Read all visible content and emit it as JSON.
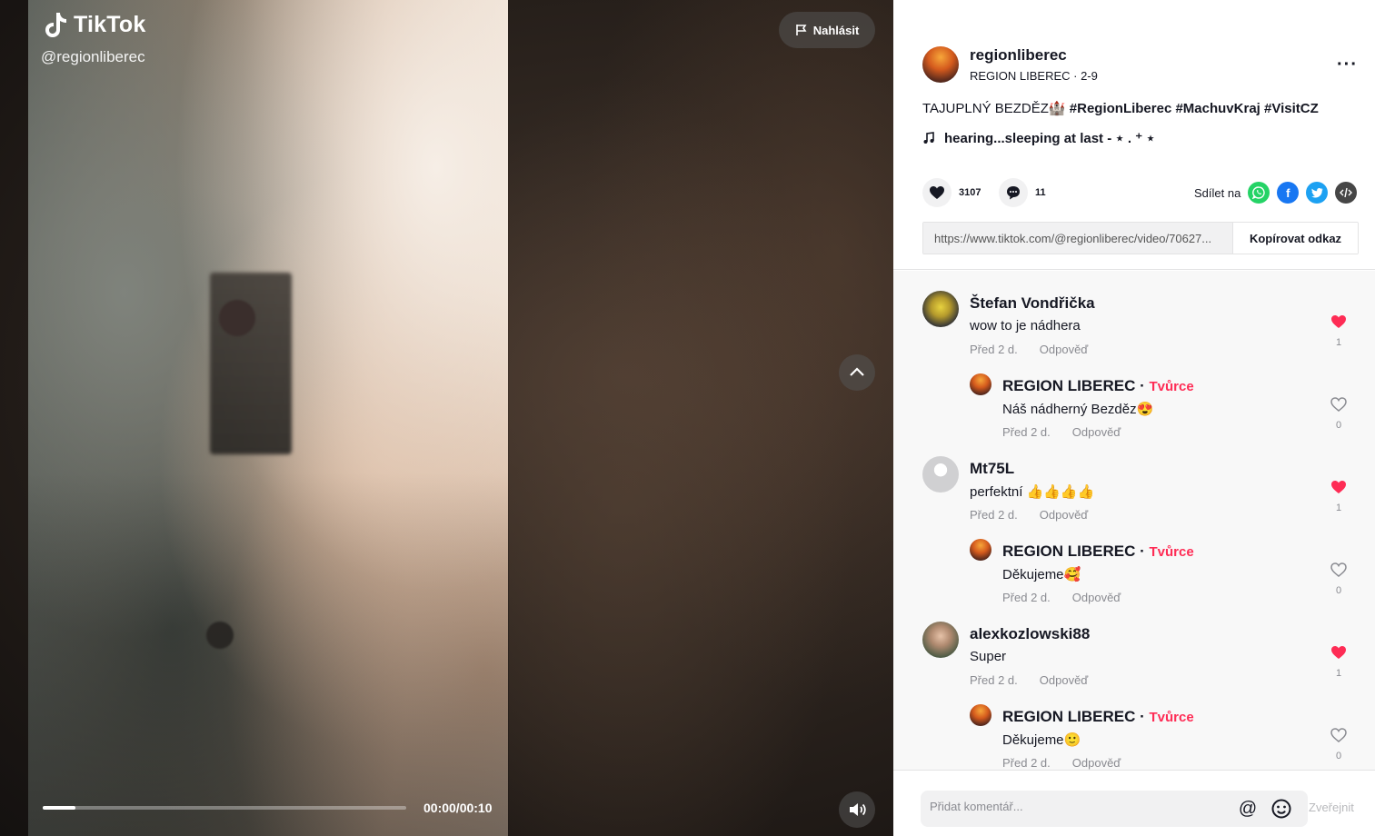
{
  "brand": {
    "name": "TikTok"
  },
  "video": {
    "handle": "@regionliberec",
    "report_label": "Nahlásit",
    "time": "00:00/00:10",
    "progress": 0.09
  },
  "author": {
    "username": "regionliberec",
    "subtitle": "REGION LIBEREC · 2-9"
  },
  "caption": {
    "text": "TAJUPLNÝ BEZDĚZ🏰",
    "tags": "#RegionLiberec #MachuvKraj #VisitCZ"
  },
  "music": {
    "icon": "music-note-icon",
    "title": "hearing...sleeping at last - ⋆ . ⁺ ⋆"
  },
  "stats": {
    "likes": "3107",
    "comments": "11"
  },
  "share": {
    "label": "Sdílet na",
    "targets": [
      {
        "name": "whatsapp-icon",
        "color": "#25d366"
      },
      {
        "name": "facebook-icon",
        "color": "#1877f2"
      },
      {
        "name": "twitter-icon",
        "color": "#1da1f2"
      },
      {
        "name": "embed-icon",
        "color": "#464646"
      }
    ]
  },
  "link": {
    "url": "https://www.tiktok.com/@regionliberec/video/70627...",
    "copy_label": "Kopírovat odkaz"
  },
  "comments": [
    {
      "user": "Štefan Vondřička",
      "text": "wow to je nádhera",
      "time": "Před 2 d.",
      "reply": "Odpověď",
      "likes": "1",
      "liked": true,
      "replies": [
        {
          "user": "REGION LIBEREC",
          "badge": "Tvůrce",
          "text": "Náš nádherný Bezděz😍",
          "time": "Před 2 d.",
          "reply": "Odpověď",
          "likes": "0",
          "liked": false
        }
      ]
    },
    {
      "user": "Mt75L",
      "text": "perfektní 👍👍👍👍",
      "time": "Před 2 d.",
      "reply": "Odpověď",
      "likes": "1",
      "liked": true,
      "replies": [
        {
          "user": "REGION LIBEREC",
          "badge": "Tvůrce",
          "text": "Děkujeme🥰",
          "time": "Před 2 d.",
          "reply": "Odpověď",
          "likes": "0",
          "liked": false
        }
      ]
    },
    {
      "user": "alexkozlowski88",
      "text": "Super",
      "time": "Před 2 d.",
      "reply": "Odpověď",
      "likes": "1",
      "liked": true,
      "replies": [
        {
          "user": "REGION LIBEREC",
          "badge": "Tvůrce",
          "text": "Děkujeme🙂",
          "time": "Před 2 d.",
          "reply": "Odpověď",
          "likes": "0",
          "liked": false
        }
      ]
    }
  ],
  "footer": {
    "placeholder": "Přidat komentář...",
    "post_label": "Zveřejnit"
  },
  "colors": {
    "accent": "#fe2c55",
    "heart": "#fe2c55"
  }
}
